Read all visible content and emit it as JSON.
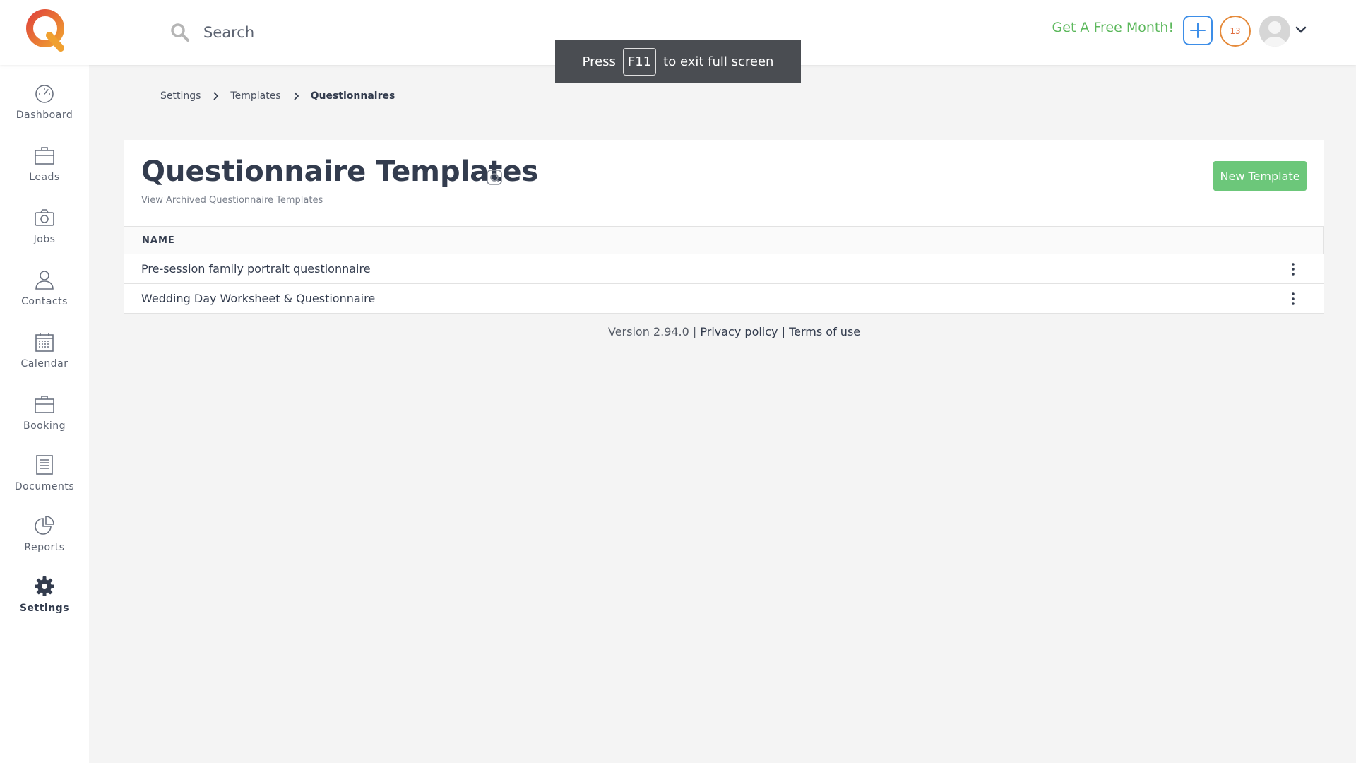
{
  "header": {
    "search_placeholder": "Search",
    "promo": "Get A Free Month!",
    "notifications_count": "13",
    "colors": {
      "promo": "#5cb85c",
      "add_button": "#3d8ee8",
      "badge": "#e58a3a"
    },
    "icons": [
      "logo-icon",
      "search-icon",
      "plus-icon",
      "avatar-icon",
      "chevron-down-icon"
    ]
  },
  "fullscreen_toast": {
    "before": "Press",
    "key": "F11",
    "after": "to exit full screen"
  },
  "sidebar": {
    "items": [
      {
        "label": "Dashboard",
        "icon": "gauge-icon",
        "active": false
      },
      {
        "label": "Leads",
        "icon": "briefcase-icon",
        "active": false
      },
      {
        "label": "Jobs",
        "icon": "camera-icon",
        "active": false
      },
      {
        "label": "Contacts",
        "icon": "person-icon",
        "active": false
      },
      {
        "label": "Calendar",
        "icon": "calendar-icon",
        "active": false
      },
      {
        "label": "Booking",
        "icon": "briefcase-icon",
        "active": false
      },
      {
        "label": "Documents",
        "icon": "document-icon",
        "active": false
      },
      {
        "label": "Reports",
        "icon": "pie-chart-icon",
        "active": false
      },
      {
        "label": "Settings",
        "icon": "gear-icon",
        "active": true
      }
    ]
  },
  "breadcrumb": {
    "items": [
      "Settings",
      "Templates"
    ],
    "current": "Questionnaires"
  },
  "main": {
    "title": "Questionnaire Templates",
    "archived_link": "View Archived Questionnaire Templates",
    "new_button": "New Template",
    "table": {
      "header": "NAME",
      "rows": [
        "Pre-session family portrait questionnaire",
        "Wedding Day Worksheet & Questionnaire"
      ]
    }
  },
  "footer": {
    "version": "Version 2.94.0 |",
    "privacy": "Privacy policy",
    "sep": "|",
    "terms": "Terms of use"
  }
}
